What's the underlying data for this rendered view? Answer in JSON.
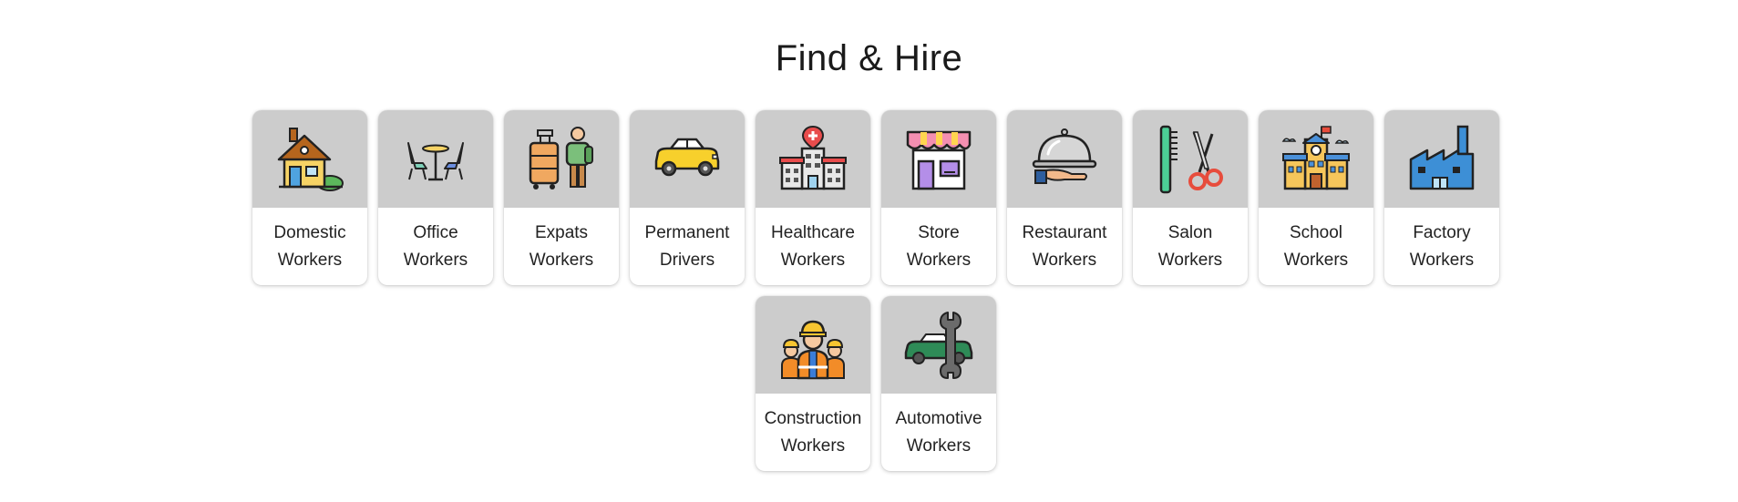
{
  "page": {
    "title": "Find & Hire"
  },
  "categories": [
    {
      "line1": "Domestic",
      "line2": "Workers",
      "icon": "house-icon"
    },
    {
      "line1": "Office",
      "line2": "Workers",
      "icon": "office-table-chairs-icon"
    },
    {
      "line1": "Expats",
      "line2": "Workers",
      "icon": "traveler-luggage-icon"
    },
    {
      "line1": "Permanent",
      "line2": "Drivers",
      "icon": "car-icon"
    },
    {
      "line1": "Healthcare",
      "line2": "Workers",
      "icon": "hospital-icon"
    },
    {
      "line1": "Store",
      "line2": "Workers",
      "icon": "storefront-icon"
    },
    {
      "line1": "Restaurant",
      "line2": "Workers",
      "icon": "serving-cloche-icon"
    },
    {
      "line1": "Salon",
      "line2": "Workers",
      "icon": "comb-scissors-icon"
    },
    {
      "line1": "School",
      "line2": "Workers",
      "icon": "school-building-icon"
    },
    {
      "line1": "Factory",
      "line2": "Workers",
      "icon": "factory-icon"
    },
    {
      "line1": "Construction",
      "line2": "Workers",
      "icon": "construction-workers-icon"
    },
    {
      "line1": "Automotive",
      "line2": "Workers",
      "icon": "car-wrench-icon"
    }
  ],
  "colors": {
    "thumb_background": "#cccccc",
    "card_background": "#ffffff",
    "text": "#222222"
  }
}
